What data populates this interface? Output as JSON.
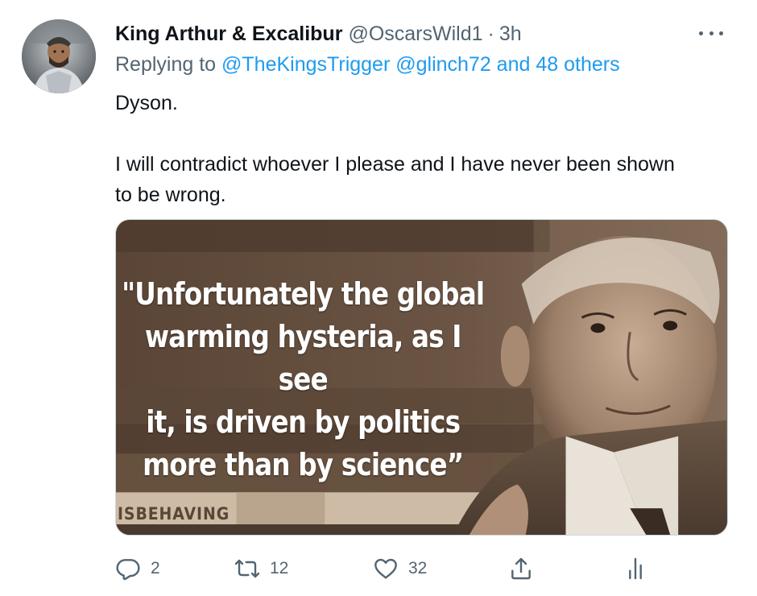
{
  "tweet": {
    "display_name": "King Arthur & Excalibur",
    "handle": "@OscarsWild1",
    "separator": "·",
    "time": "3h",
    "more_icon": "more-horizontal-icon",
    "reply_prefix": "Replying to",
    "reply_mentions": "@TheKingsTrigger @glinch72 and 48 others",
    "body_line1": "Dyson.",
    "body_line2": "I will contradict whoever I please and I have never been shown to be wrong.",
    "media": {
      "quote_line1": "\"Unfortunately the global",
      "quote_line2": "warming hysteria, as I see",
      "quote_line3": "it, is driven by politics",
      "quote_line4": "more than by science”",
      "book_title": "ISBEHAVING"
    },
    "actions": {
      "reply_count": "2",
      "retweet_count": "12",
      "like_count": "32",
      "reply_icon": "reply-icon",
      "retweet_icon": "retweet-icon",
      "like_icon": "heart-icon",
      "share_icon": "share-icon",
      "analytics_icon": "analytics-icon"
    }
  },
  "colors": {
    "text": "#0f1419",
    "secondary": "#536471",
    "link": "#1d9bf0",
    "background": "#ffffff"
  }
}
